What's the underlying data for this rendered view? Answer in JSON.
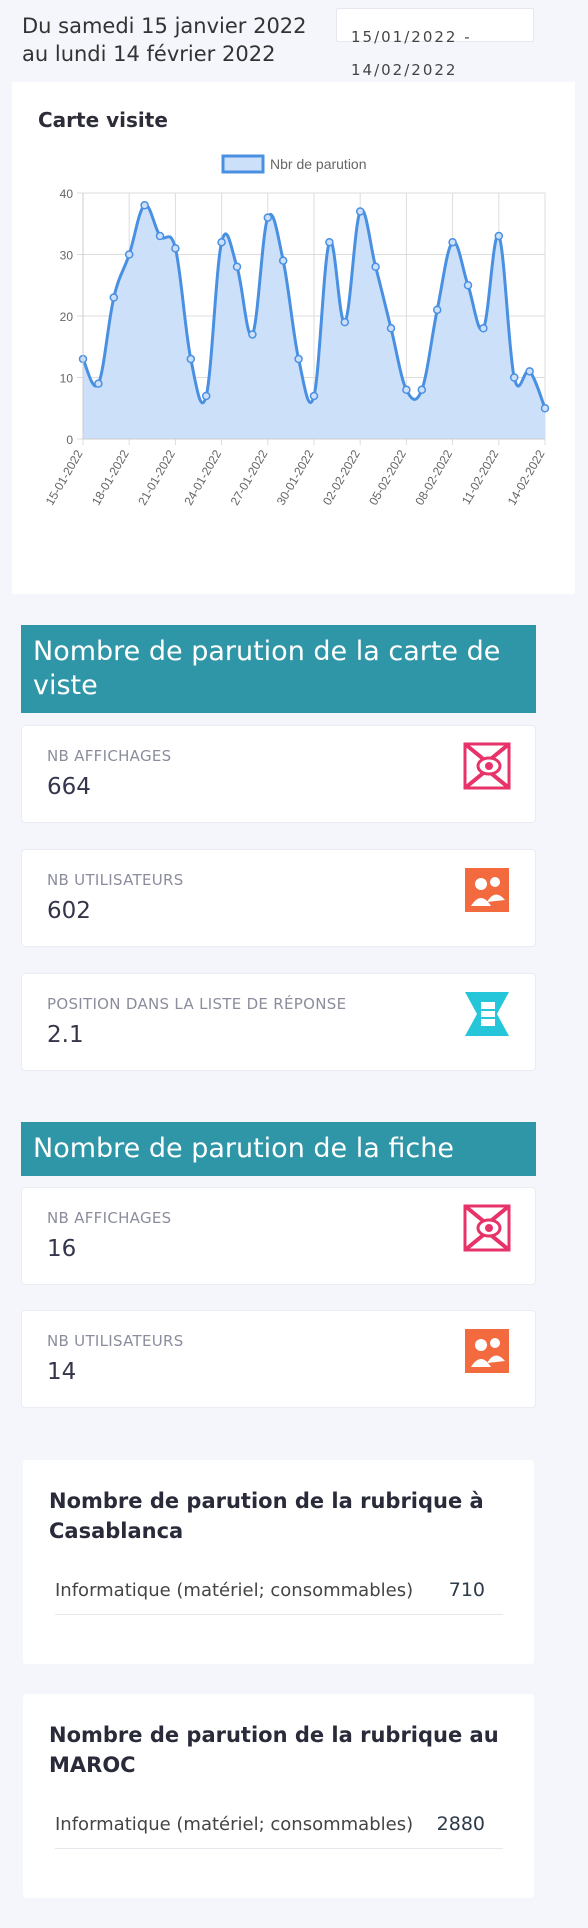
{
  "header": {
    "line1": "Du samedi 15 janvier 2022",
    "line2": "au lundi 14 février 2022",
    "date_range_value": "15/01/2022 - 14/02/2022"
  },
  "chart_card": {
    "title": "Carte visite"
  },
  "chart_data": {
    "type": "area",
    "title": "Carte visite",
    "legend": "top",
    "series": [
      {
        "name": "Nbr de parution",
        "color": "#4a90e2",
        "values": [
          13,
          9,
          23,
          30,
          38,
          33,
          31,
          13,
          7,
          32,
          28,
          17,
          36,
          29,
          13,
          7,
          32,
          19,
          37,
          28,
          18,
          8,
          8,
          21,
          32,
          25,
          18,
          33,
          10,
          11,
          5
        ]
      }
    ],
    "x": [
      "15-01-2022",
      "16-01-2022",
      "17-01-2022",
      "18-01-2022",
      "19-01-2022",
      "20-01-2022",
      "21-01-2022",
      "22-01-2022",
      "23-01-2022",
      "24-01-2022",
      "25-01-2022",
      "26-01-2022",
      "27-01-2022",
      "28-01-2022",
      "29-01-2022",
      "30-01-2022",
      "31-01-2022",
      "01-02-2022",
      "02-02-2022",
      "03-02-2022",
      "04-02-2022",
      "05-02-2022",
      "06-02-2022",
      "07-02-2022",
      "08-02-2022",
      "09-02-2022",
      "10-02-2022",
      "11-02-2022",
      "12-02-2022",
      "13-02-2022",
      "14-02-2022"
    ],
    "x_tick_labels": [
      "15-01-2022",
      "18-01-2022",
      "21-01-2022",
      "24-01-2022",
      "27-01-2022",
      "30-01-2022",
      "02-02-2022",
      "05-02-2022",
      "08-02-2022",
      "11-02-2022",
      "14-02-2022"
    ],
    "y_ticks": [
      0,
      10,
      20,
      30,
      40
    ],
    "ylim": [
      0,
      40
    ],
    "grid": true
  },
  "section_carte": {
    "title": "Nombre de parution de la carte de viste",
    "stats": [
      {
        "label": "NB AFFICHAGES",
        "value": "664",
        "icon": "eye-icon",
        "color": "#e8336a"
      },
      {
        "label": "NB UTILISATEURS",
        "value": "602",
        "icon": "users-icon",
        "color": "#f26a3d"
      },
      {
        "label": "POSITION DANS LA LISTE DE RÉPONSE",
        "value": "2.1",
        "icon": "list-position-icon",
        "color": "#26c6da"
      }
    ]
  },
  "section_fiche": {
    "title": "Nombre de parution de la fiche",
    "stats": [
      {
        "label": "NB AFFICHAGES",
        "value": "16",
        "icon": "eye-icon",
        "color": "#e8336a"
      },
      {
        "label": "NB UTILISATEURS",
        "value": "14",
        "icon": "users-icon",
        "color": "#f26a3d"
      }
    ]
  },
  "rubrique_casablanca": {
    "title": "Nombre de parution de la rubrique à Casablanca",
    "rows": [
      {
        "name": "Informatique (matériel; consommables)",
        "count": "710"
      }
    ]
  },
  "rubrique_maroc": {
    "title": "Nombre de parution de la rubrique au MAROC",
    "rows": [
      {
        "name": "Informatique (matériel; consommables)",
        "count": "2880"
      }
    ]
  }
}
